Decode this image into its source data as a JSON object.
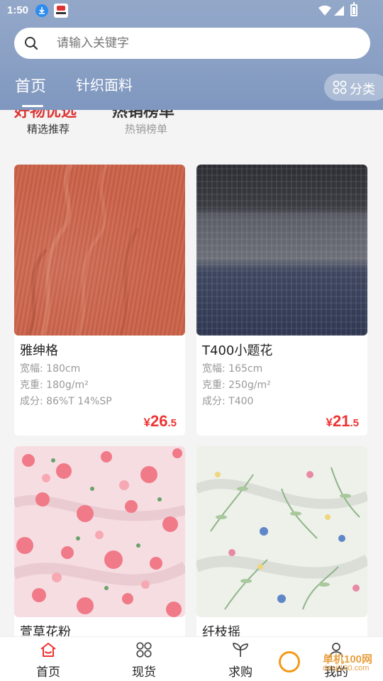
{
  "status": {
    "time": "1:50"
  },
  "search": {
    "placeholder": "请输入关键字"
  },
  "tabs": {
    "home": "首页",
    "knit": "针织面料",
    "category": "分类"
  },
  "subtabs": {
    "featured_title": "好物优选",
    "featured_label": "精选推荐",
    "hot_title": "热销榜单",
    "hot_label": "热销榜单"
  },
  "products": [
    {
      "name": "雅绅格",
      "width": "宽幅: 180cm",
      "weight": "克重: 180g/m²",
      "content": "成分: 86%T 14%SP",
      "price_symbol": "¥",
      "price_int": "26",
      "price_dec": ".5"
    },
    {
      "name": "T400小题花",
      "width": "宽幅: 165cm",
      "weight": "克重: 250g/m²",
      "content": "成分: T400",
      "price_symbol": "¥",
      "price_int": "21",
      "price_dec": ".5"
    },
    {
      "name": "萱草花粉"
    },
    {
      "name": "纤枝摇"
    }
  ],
  "nav": {
    "home": "首页",
    "stock": "现货",
    "request": "求购",
    "mine": "我的"
  },
  "watermark": {
    "text": "单机100网",
    "sub": "danji100.com"
  },
  "colors": {
    "accent": "#e33333",
    "header": "#8aa0c4"
  }
}
